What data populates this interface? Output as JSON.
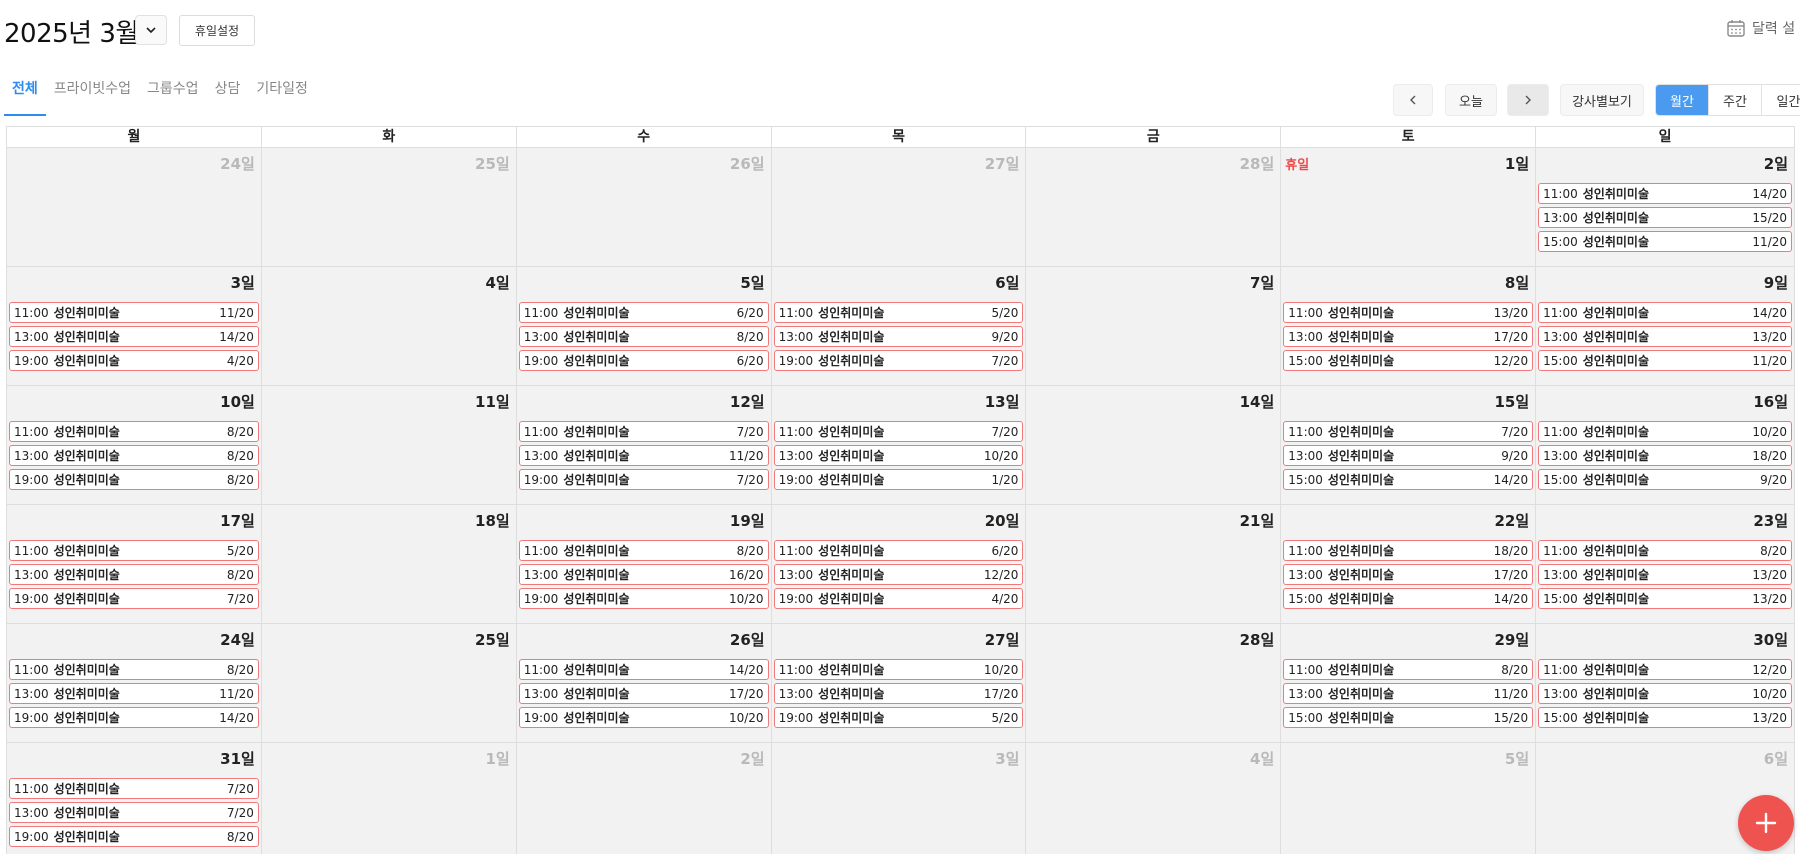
{
  "header": {
    "month_title": "2025년 3월",
    "holiday_settings": "휴일설정",
    "calendar_settings": "달력 설"
  },
  "tabs": [
    {
      "label": "전체",
      "active": true
    },
    {
      "label": "프라이빗수업",
      "active": false
    },
    {
      "label": "그룹수업",
      "active": false
    },
    {
      "label": "상담",
      "active": false
    },
    {
      "label": "기타일정",
      "active": false
    }
  ],
  "nav": {
    "today": "오늘",
    "by_instructor": "강사별보기",
    "views": [
      {
        "label": "월간",
        "active": true
      },
      {
        "label": "주간",
        "active": false
      },
      {
        "label": "일간",
        "active": false
      }
    ]
  },
  "weekdays": [
    "월",
    "화",
    "수",
    "목",
    "금",
    "토",
    "일"
  ],
  "holiday_label": "휴일",
  "weeks": [
    [
      {
        "label": "24일",
        "other": true,
        "events": []
      },
      {
        "label": "25일",
        "other": true,
        "events": []
      },
      {
        "label": "26일",
        "other": true,
        "events": []
      },
      {
        "label": "27일",
        "other": true,
        "events": []
      },
      {
        "label": "28일",
        "other": true,
        "events": []
      },
      {
        "label": "1일",
        "other": false,
        "holiday": true,
        "events": []
      },
      {
        "label": "2일",
        "other": false,
        "events": [
          {
            "time": "11:00",
            "name": "성인취미미술",
            "count": "14/20"
          },
          {
            "time": "13:00",
            "name": "성인취미미술",
            "count": "15/20"
          },
          {
            "time": "15:00",
            "name": "성인취미미술",
            "count": "11/20"
          }
        ]
      }
    ],
    [
      {
        "label": "3일",
        "other": false,
        "events": [
          {
            "time": "11:00",
            "name": "성인취미미술",
            "count": "11/20"
          },
          {
            "time": "13:00",
            "name": "성인취미미술",
            "count": "14/20"
          },
          {
            "time": "19:00",
            "name": "성인취미미술",
            "count": "4/20"
          }
        ]
      },
      {
        "label": "4일",
        "other": false,
        "events": []
      },
      {
        "label": "5일",
        "other": false,
        "events": [
          {
            "time": "11:00",
            "name": "성인취미미술",
            "count": "6/20"
          },
          {
            "time": "13:00",
            "name": "성인취미미술",
            "count": "8/20"
          },
          {
            "time": "19:00",
            "name": "성인취미미술",
            "count": "6/20"
          }
        ]
      },
      {
        "label": "6일",
        "other": false,
        "events": [
          {
            "time": "11:00",
            "name": "성인취미미술",
            "count": "5/20"
          },
          {
            "time": "13:00",
            "name": "성인취미미술",
            "count": "9/20"
          },
          {
            "time": "19:00",
            "name": "성인취미미술",
            "count": "7/20"
          }
        ]
      },
      {
        "label": "7일",
        "other": false,
        "events": []
      },
      {
        "label": "8일",
        "other": false,
        "events": [
          {
            "time": "11:00",
            "name": "성인취미미술",
            "count": "13/20"
          },
          {
            "time": "13:00",
            "name": "성인취미미술",
            "count": "17/20"
          },
          {
            "time": "15:00",
            "name": "성인취미미술",
            "count": "12/20"
          }
        ]
      },
      {
        "label": "9일",
        "other": false,
        "events": [
          {
            "time": "11:00",
            "name": "성인취미미술",
            "count": "14/20"
          },
          {
            "time": "13:00",
            "name": "성인취미미술",
            "count": "13/20"
          },
          {
            "time": "15:00",
            "name": "성인취미미술",
            "count": "11/20"
          }
        ]
      }
    ],
    [
      {
        "label": "10일",
        "other": false,
        "events": [
          {
            "time": "11:00",
            "name": "성인취미미술",
            "count": "8/20"
          },
          {
            "time": "13:00",
            "name": "성인취미미술",
            "count": "8/20"
          },
          {
            "time": "19:00",
            "name": "성인취미미술",
            "count": "8/20"
          }
        ]
      },
      {
        "label": "11일",
        "other": false,
        "events": []
      },
      {
        "label": "12일",
        "other": false,
        "events": [
          {
            "time": "11:00",
            "name": "성인취미미술",
            "count": "7/20"
          },
          {
            "time": "13:00",
            "name": "성인취미미술",
            "count": "11/20"
          },
          {
            "time": "19:00",
            "name": "성인취미미술",
            "count": "7/20"
          }
        ]
      },
      {
        "label": "13일",
        "other": false,
        "events": [
          {
            "time": "11:00",
            "name": "성인취미미술",
            "count": "7/20"
          },
          {
            "time": "13:00",
            "name": "성인취미미술",
            "count": "10/20"
          },
          {
            "time": "19:00",
            "name": "성인취미미술",
            "count": "1/20"
          }
        ]
      },
      {
        "label": "14일",
        "other": false,
        "events": []
      },
      {
        "label": "15일",
        "other": false,
        "events": [
          {
            "time": "11:00",
            "name": "성인취미미술",
            "count": "7/20"
          },
          {
            "time": "13:00",
            "name": "성인취미미술",
            "count": "9/20"
          },
          {
            "time": "15:00",
            "name": "성인취미미술",
            "count": "14/20"
          }
        ]
      },
      {
        "label": "16일",
        "other": false,
        "events": [
          {
            "time": "11:00",
            "name": "성인취미미술",
            "count": "10/20"
          },
          {
            "time": "13:00",
            "name": "성인취미미술",
            "count": "18/20"
          },
          {
            "time": "15:00",
            "name": "성인취미미술",
            "count": "9/20"
          }
        ]
      }
    ],
    [
      {
        "label": "17일",
        "other": false,
        "events": [
          {
            "time": "11:00",
            "name": "성인취미미술",
            "count": "5/20"
          },
          {
            "time": "13:00",
            "name": "성인취미미술",
            "count": "8/20"
          },
          {
            "time": "19:00",
            "name": "성인취미미술",
            "count": "7/20"
          }
        ]
      },
      {
        "label": "18일",
        "other": false,
        "events": []
      },
      {
        "label": "19일",
        "other": false,
        "events": [
          {
            "time": "11:00",
            "name": "성인취미미술",
            "count": "8/20"
          },
          {
            "time": "13:00",
            "name": "성인취미미술",
            "count": "16/20"
          },
          {
            "time": "19:00",
            "name": "성인취미미술",
            "count": "10/20"
          }
        ]
      },
      {
        "label": "20일",
        "other": false,
        "events": [
          {
            "time": "11:00",
            "name": "성인취미미술",
            "count": "6/20"
          },
          {
            "time": "13:00",
            "name": "성인취미미술",
            "count": "12/20"
          },
          {
            "time": "19:00",
            "name": "성인취미미술",
            "count": "4/20"
          }
        ]
      },
      {
        "label": "21일",
        "other": false,
        "events": []
      },
      {
        "label": "22일",
        "other": false,
        "events": [
          {
            "time": "11:00",
            "name": "성인취미미술",
            "count": "18/20"
          },
          {
            "time": "13:00",
            "name": "성인취미미술",
            "count": "17/20"
          },
          {
            "time": "15:00",
            "name": "성인취미미술",
            "count": "14/20"
          }
        ]
      },
      {
        "label": "23일",
        "other": false,
        "events": [
          {
            "time": "11:00",
            "name": "성인취미미술",
            "count": "8/20"
          },
          {
            "time": "13:00",
            "name": "성인취미미술",
            "count": "13/20"
          },
          {
            "time": "15:00",
            "name": "성인취미미술",
            "count": "13/20"
          }
        ]
      }
    ],
    [
      {
        "label": "24일",
        "other": false,
        "events": [
          {
            "time": "11:00",
            "name": "성인취미미술",
            "count": "8/20"
          },
          {
            "time": "13:00",
            "name": "성인취미미술",
            "count": "11/20"
          },
          {
            "time": "19:00",
            "name": "성인취미미술",
            "count": "14/20"
          }
        ]
      },
      {
        "label": "25일",
        "other": false,
        "events": []
      },
      {
        "label": "26일",
        "other": false,
        "events": [
          {
            "time": "11:00",
            "name": "성인취미미술",
            "count": "14/20"
          },
          {
            "time": "13:00",
            "name": "성인취미미술",
            "count": "17/20"
          },
          {
            "time": "19:00",
            "name": "성인취미미술",
            "count": "10/20"
          }
        ]
      },
      {
        "label": "27일",
        "other": false,
        "events": [
          {
            "time": "11:00",
            "name": "성인취미미술",
            "count": "10/20"
          },
          {
            "time": "13:00",
            "name": "성인취미미술",
            "count": "17/20"
          },
          {
            "time": "19:00",
            "name": "성인취미미술",
            "count": "5/20"
          }
        ]
      },
      {
        "label": "28일",
        "other": false,
        "events": []
      },
      {
        "label": "29일",
        "other": false,
        "events": [
          {
            "time": "11:00",
            "name": "성인취미미술",
            "count": "8/20"
          },
          {
            "time": "13:00",
            "name": "성인취미미술",
            "count": "11/20"
          },
          {
            "time": "15:00",
            "name": "성인취미미술",
            "count": "15/20"
          }
        ]
      },
      {
        "label": "30일",
        "other": false,
        "events": [
          {
            "time": "11:00",
            "name": "성인취미미술",
            "count": "12/20"
          },
          {
            "time": "13:00",
            "name": "성인취미미술",
            "count": "10/20"
          },
          {
            "time": "15:00",
            "name": "성인취미미술",
            "count": "13/20"
          }
        ]
      }
    ],
    [
      {
        "label": "31일",
        "other": false,
        "events": [
          {
            "time": "11:00",
            "name": "성인취미미술",
            "count": "7/20"
          },
          {
            "time": "13:00",
            "name": "성인취미미술",
            "count": "7/20"
          },
          {
            "time": "19:00",
            "name": "성인취미미술",
            "count": "8/20"
          }
        ]
      },
      {
        "label": "1일",
        "other": true,
        "events": []
      },
      {
        "label": "2일",
        "other": true,
        "events": []
      },
      {
        "label": "3일",
        "other": true,
        "events": []
      },
      {
        "label": "4일",
        "other": true,
        "events": []
      },
      {
        "label": "5일",
        "other": true,
        "events": []
      },
      {
        "label": "6일",
        "other": true,
        "events": []
      }
    ]
  ],
  "icons": {
    "dropdown": "chevron-down-icon",
    "calendar": "calendar-icon",
    "prev": "chevron-left-icon",
    "next": "chevron-right-icon",
    "add": "plus-icon"
  },
  "colors": {
    "accent": "#4a9bef",
    "event_border": "#f07a7a",
    "holiday_text": "#ef4a4a",
    "fab": "#ef5350"
  }
}
